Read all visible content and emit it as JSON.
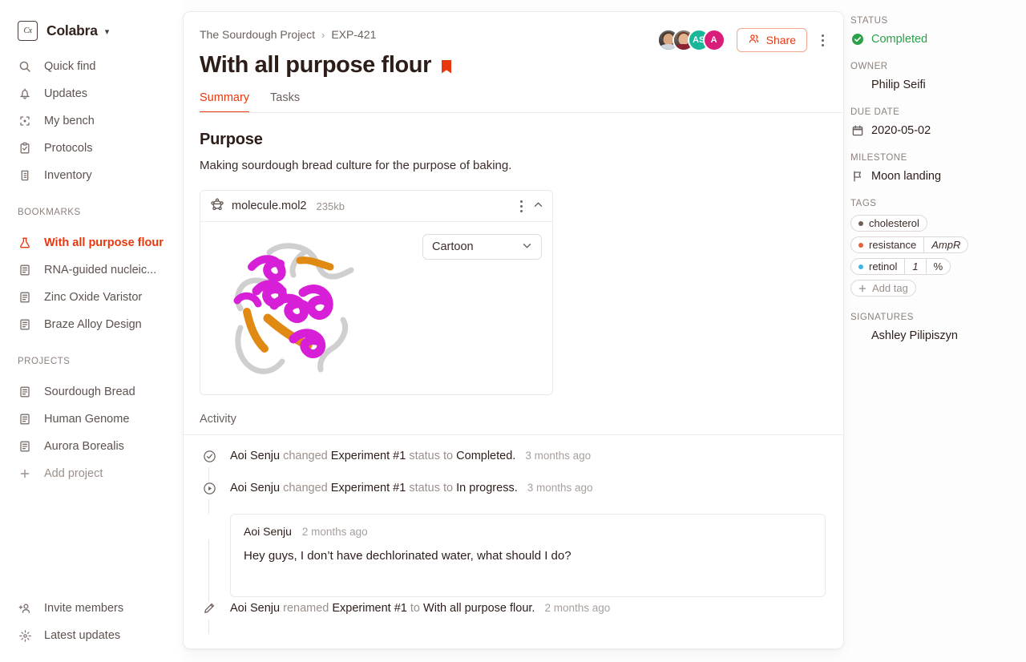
{
  "brand": {
    "name": "Colabra",
    "logo_text": "Cx",
    "caret_icon": "chevron-down-icon"
  },
  "sidebar": {
    "primary": [
      {
        "label": "Quick find",
        "icon": "search-icon"
      },
      {
        "label": "Updates",
        "icon": "bell-icon"
      },
      {
        "label": "My bench",
        "icon": "focus-target-icon"
      },
      {
        "label": "Protocols",
        "icon": "clipboard-check-icon"
      },
      {
        "label": "Inventory",
        "icon": "beaker-icon"
      }
    ],
    "bookmarks_label": "BOOKMARKS",
    "bookmarks": [
      {
        "label": "With all purpose flour",
        "icon": "flask-icon",
        "active": true
      },
      {
        "label": "RNA-guided nucleic...",
        "icon": "document-icon",
        "active": false
      },
      {
        "label": "Zinc Oxide Varistor",
        "icon": "document-icon",
        "active": false
      },
      {
        "label": "Braze Alloy Design",
        "icon": "document-icon",
        "active": false
      }
    ],
    "projects_label": "PROJECTS",
    "projects": [
      {
        "label": "Sourdough Bread",
        "icon": "document-icon"
      },
      {
        "label": "Human Genome",
        "icon": "document-icon"
      },
      {
        "label": "Aurora Borealis",
        "icon": "document-icon"
      }
    ],
    "add_project": {
      "label": "Add project",
      "icon": "plus-icon"
    },
    "bottom": [
      {
        "label": "Invite members",
        "icon": "add-person-icon"
      },
      {
        "label": "Latest updates",
        "icon": "sparkle-icon"
      }
    ]
  },
  "header": {
    "breadcrumb": {
      "project": "The Sourdough Project",
      "separator": "›",
      "item": "EXP-421"
    },
    "title": "With all purpose flour",
    "bookmark_icon": "bookmark-flag-icon",
    "tabs": [
      {
        "label": "Summary",
        "active": true
      },
      {
        "label": "Tasks",
        "active": false
      }
    ],
    "share": {
      "label": "Share",
      "icon": "people-icon"
    },
    "more_icon": "kebab-menu-icon",
    "avatars": [
      {
        "initials": "",
        "type": "photo",
        "bg": "#2f2a27",
        "hair": "#4b3a2c",
        "skin": "#d8a882",
        "body": "#cfd6dd"
      },
      {
        "initials": "",
        "type": "photo",
        "bg": "#3a2f2a",
        "hair": "#6b3d24",
        "skin": "#e3b392",
        "body": "#8f2233"
      },
      {
        "initials": "AS",
        "type": "initials",
        "bg": "#18b79a"
      },
      {
        "initials": "A",
        "type": "initials",
        "bg": "#d91e7a"
      }
    ]
  },
  "main": {
    "purpose_heading": "Purpose",
    "purpose_text": "Making sourdough bread culture for the purpose of baking.",
    "molecule": {
      "icon": "molecule-icon",
      "filename": "molecule.mol2",
      "filesize": "235kb",
      "menu_icon": "kebab-menu-icon",
      "collapse_icon": "chevron-up-icon",
      "style_value": "Cartoon",
      "style_caret": "chevron-down-icon",
      "render_colors": {
        "helix": "#d81fd8",
        "sheet": "#e08a14",
        "loop": "#c9c9c9"
      }
    },
    "activity_heading": "Activity",
    "activity": [
      {
        "type": "event",
        "icon": "check-circle-icon",
        "actor": "Aoi Senju",
        "verb": "changed",
        "object": "Experiment #1",
        "mid": "status to",
        "target": "Completed.",
        "time": "3 months ago"
      },
      {
        "type": "event",
        "icon": "play-circle-icon",
        "actor": "Aoi Senju",
        "verb": "changed",
        "object": "Experiment #1",
        "mid": "status to",
        "target": "In progress.",
        "time": "3 months ago"
      },
      {
        "type": "comment",
        "icon": "avatar-icon",
        "actor": "Aoi Senju",
        "time": "2 months ago",
        "body": "Hey guys, I don’t have dechlorinated water, what should I do?"
      },
      {
        "type": "event",
        "icon": "pencil-icon",
        "actor": "Aoi Senju",
        "verb": "renamed",
        "object": "Experiment #1",
        "mid": "to",
        "target": "With all purpose flour.",
        "time": "2 months ago"
      }
    ]
  },
  "rightpanel": {
    "status_label": "STATUS",
    "status_value": "Completed",
    "status_icon": "check-circle-filled-icon",
    "status_color": "#2ca14a",
    "owner_label": "OWNER",
    "owner_value": "Philip Seifi",
    "due_label": "DUE DATE",
    "due_value": "2020-05-02",
    "due_icon": "calendar-icon",
    "milestone_label": "MILESTONE",
    "milestone_value": "Moon landing",
    "milestone_icon": "flag-icon",
    "tags_label": "TAGS",
    "tags": [
      {
        "name": "cholesterol",
        "dot": "#6e5d57",
        "value": null,
        "unit": null
      },
      {
        "name": "resistance",
        "dot": "#e8603a",
        "value": "AmpR",
        "unit": null
      },
      {
        "name": "retinol",
        "dot": "#3ab6e8",
        "value": "1",
        "unit": "%"
      }
    ],
    "add_tag": {
      "label": "Add tag",
      "icon": "plus-icon"
    },
    "signatures_label": "SIGNATURES",
    "signature_value": "Ashley Pilipiszyn"
  }
}
